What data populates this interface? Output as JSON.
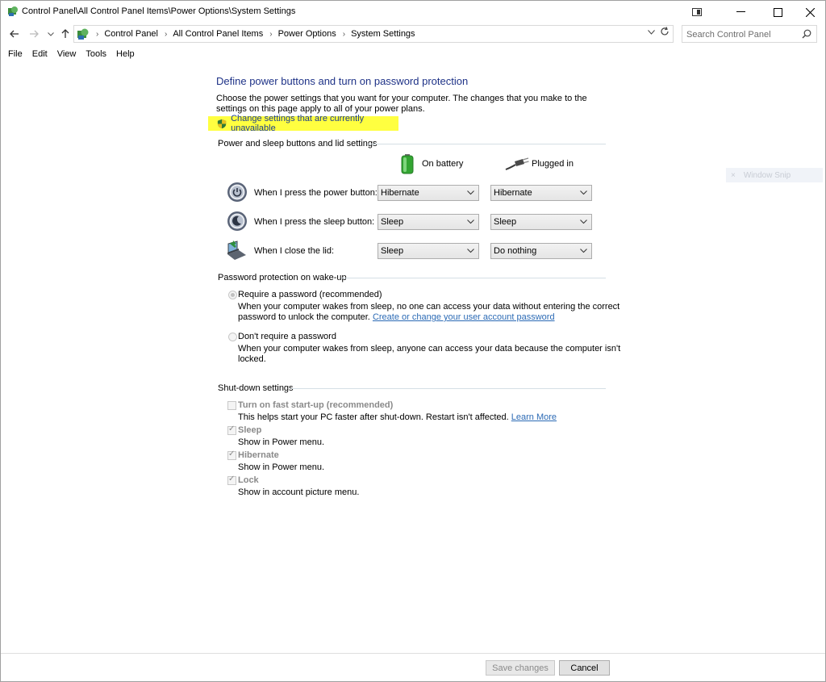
{
  "window": {
    "title": "Control Panel\\All Control Panel Items\\Power Options\\System Settings"
  },
  "nav": {
    "breadcrumbs": [
      "Control Panel",
      "All Control Panel Items",
      "Power Options",
      "System Settings"
    ],
    "search_placeholder": "Search Control Panel"
  },
  "menu": [
    "File",
    "Edit",
    "View",
    "Tools",
    "Help"
  ],
  "main": {
    "heading": "Define power buttons and turn on password protection",
    "description": "Choose the power settings that you want for your computer. The changes that you make to the settings on this page apply to all of your power plans.",
    "change_settings_link": "Change settings that are currently unavailable",
    "highlight_color": "#ffff40",
    "power_section": {
      "label": "Power and sleep buttons and lid settings",
      "col_battery": "On battery",
      "col_plugged": "Plugged in",
      "rows": [
        {
          "label": "When I press the power button:",
          "battery": "Hibernate",
          "plugged": "Hibernate",
          "icon": "power-button-icon"
        },
        {
          "label": "When I press the sleep button:",
          "battery": "Sleep",
          "plugged": "Sleep",
          "icon": "sleep-button-icon"
        },
        {
          "label": "When I close the lid:",
          "battery": "Sleep",
          "plugged": "Do nothing",
          "icon": "laptop-lid-icon"
        }
      ]
    },
    "password_section": {
      "label": "Password protection on wake-up",
      "require_label": "Require a password (recommended)",
      "require_desc_1": "When your computer wakes from sleep, no one can access your data without entering the correct",
      "require_desc_2": "password to unlock the computer.",
      "require_link": "Create or change your user account password",
      "norequire_label": "Don't require a password",
      "norequire_desc_1": "When your computer wakes from sleep, anyone can access your data because the computer isn't",
      "norequire_desc_2": "locked."
    },
    "shutdown_section": {
      "label": "Shut-down settings",
      "items": [
        {
          "label": "Turn on fast start-up (recommended)",
          "desc": "This helps start your PC faster after shut-down. Restart isn't affected.",
          "link": "Learn More",
          "checked": false
        },
        {
          "label": "Sleep",
          "desc": "Show in Power menu.",
          "checked": true
        },
        {
          "label": "Hibernate",
          "desc": "Show in Power menu.",
          "checked": true
        },
        {
          "label": "Lock",
          "desc": "Show in account picture menu.",
          "checked": true
        }
      ]
    }
  },
  "footer": {
    "save_label": "Save changes",
    "cancel_label": "Cancel"
  },
  "overlay": {
    "ghost_label": "Window Snip"
  }
}
